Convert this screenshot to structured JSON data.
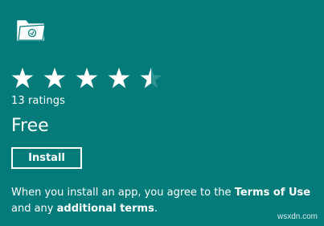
{
  "app": {
    "icon": "folder-icon"
  },
  "rating": {
    "value": 4.5,
    "max": 5,
    "count_text": "13 ratings"
  },
  "price": "Free",
  "install_button": "Install",
  "terms": {
    "prefix": "When you install an app, you agree to the",
    "terms_link": "Terms of Use",
    "middle": "and any",
    "additional_link": "additional terms",
    "suffix": "."
  },
  "watermark": "wsxdn.com",
  "colors": {
    "background": "#037b7a",
    "foreground": "#ffffff"
  }
}
